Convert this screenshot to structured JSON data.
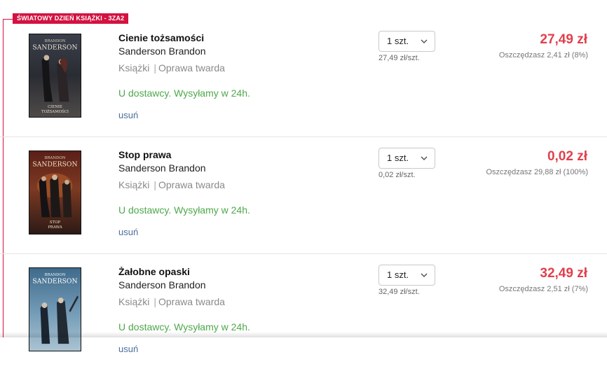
{
  "promo": {
    "badge": "ŚWIATOWY DZIEŃ KSIĄŻKI - 3ZA2",
    "color": "#d3123f"
  },
  "cover_text": {
    "author_first": "BRANDON",
    "author_last": "SANDERSON"
  },
  "items": [
    {
      "title": "Cienie tożsamości",
      "author": "Sanderson Brandon",
      "category": "Książki",
      "binding": "Oprawa twarda",
      "availability": "U dostawcy. Wysyłamy w 24h.",
      "remove": "usuń",
      "quantity": "1 szt.",
      "unit_price": "27,49 zł/szt.",
      "price": "27,49 zł",
      "savings": "Oszczędzasz 2,41 zł (8%)",
      "cover_title_1": "CIENIE",
      "cover_title_2": "TOŻSAMOŚCI"
    },
    {
      "title": "Stop prawa",
      "author": "Sanderson Brandon",
      "category": "Książki",
      "binding": "Oprawa twarda",
      "availability": "U dostawcy. Wysyłamy w 24h.",
      "remove": "usuń",
      "quantity": "1 szt.",
      "unit_price": "0,02 zł/szt.",
      "price": "0,02 zł",
      "savings": "Oszczędzasz 29,88 zł (100%)",
      "cover_title_1": "STOP",
      "cover_title_2": "PRAWA"
    },
    {
      "title": "Żałobne opaski",
      "author": "Sanderson Brandon",
      "category": "Książki",
      "binding": "Oprawa twarda",
      "availability": "U dostawcy. Wysyłamy w 24h.",
      "remove": "usuń",
      "quantity": "1 szt.",
      "unit_price": "32,49 zł/szt.",
      "price": "32,49 zł",
      "savings": "Oszczędzasz 2,51 zł (7%)",
      "cover_title_1": "",
      "cover_title_2": ""
    }
  ],
  "colors": {
    "price": "#e0404d",
    "availability": "#4ea84a",
    "link": "#4a6e9a"
  }
}
